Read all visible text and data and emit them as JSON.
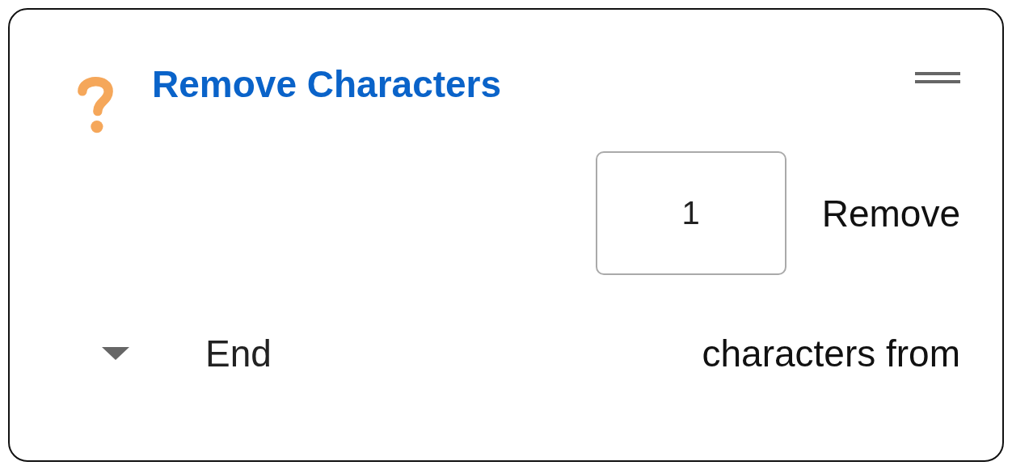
{
  "title": "Remove Characters",
  "count_field": {
    "value": "1"
  },
  "remove_label": "Remove",
  "position_dropdown": {
    "value": "End"
  },
  "characters_from_label": "characters from"
}
